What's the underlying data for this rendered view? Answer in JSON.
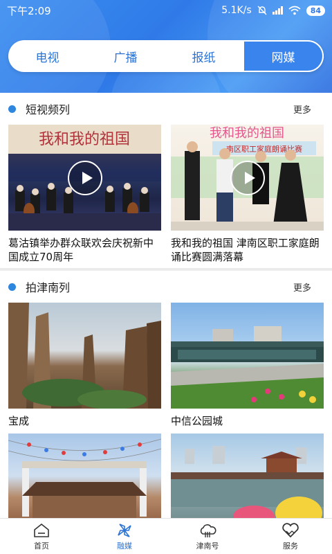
{
  "status": {
    "time": "下午2:09",
    "net_speed": "5.1K/s",
    "battery": "84"
  },
  "tabs": [
    {
      "label": "电视",
      "active": false
    },
    {
      "label": "广播",
      "active": false
    },
    {
      "label": "报纸",
      "active": false
    },
    {
      "label": "网媒",
      "active": true
    }
  ],
  "sections": [
    {
      "title": "短视频列",
      "more": "更多",
      "items": [
        {
          "caption": "葛沽镇举办群众联欢会庆祝新中国成立70周年",
          "banner": "我和我的祖国",
          "video": true
        },
        {
          "caption": "我和我的祖国 津南区职工家庭朗诵比赛圆满落幕",
          "banner": "南区职工家庭朗诵比赛",
          "video": true
        }
      ]
    },
    {
      "title": "拍津南列",
      "more": "更多",
      "items": [
        {
          "caption": "宝成"
        },
        {
          "caption": "中信公园城"
        },
        {
          "caption": ""
        },
        {
          "caption": ""
        }
      ]
    }
  ],
  "bottom_nav": [
    {
      "label": "首页",
      "icon": "home-icon",
      "active": false
    },
    {
      "label": "融媒",
      "icon": "pinwheel-icon",
      "active": true
    },
    {
      "label": "津南号",
      "icon": "cloud-icon",
      "active": false
    },
    {
      "label": "服务",
      "icon": "handshake-heart-icon",
      "active": false
    }
  ],
  "colors": {
    "brand": "#3a84ee",
    "accent_dot": "#2e86de",
    "nav_active": "#2b74d6"
  }
}
